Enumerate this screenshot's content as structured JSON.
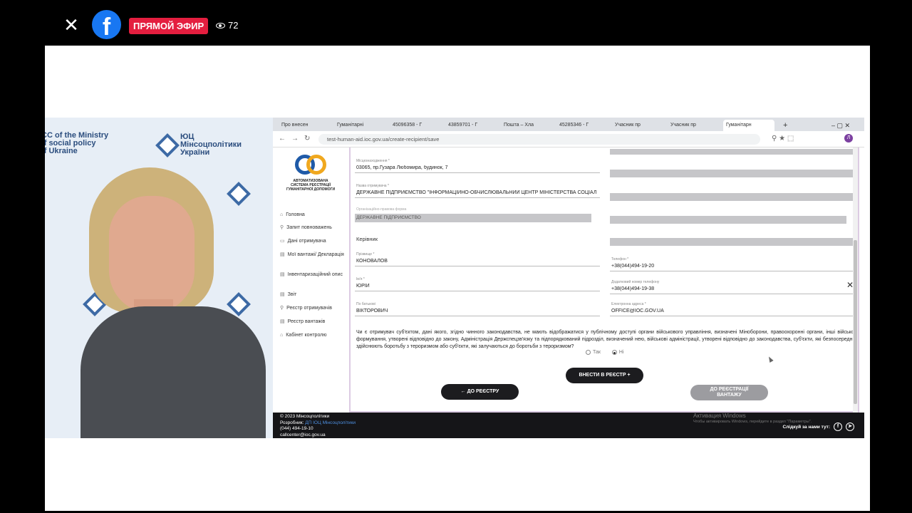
{
  "fb": {
    "live_label": "ПРЯМОЙ ЭФИР",
    "viewers": "72",
    "logo_letter": "f",
    "close": "✕"
  },
  "cam": {
    "logo_ua": "ЮЦ\nМінсоцполітики\nУкраїни",
    "logo_en": "ICC of the Ministry\nof social policy\nof Ukraine"
  },
  "browser": {
    "tabs": [
      "Про внесен",
      "Гуманітарні",
      "45096358 - Г",
      "43859701 - Г",
      "Пошта – Хла",
      "45285346 - Г",
      "Учасник пр",
      "Учасник пр",
      "Гуманітарн"
    ],
    "url": "test-human-aid.ioc.gov.ua/create-recipient/save"
  },
  "sidebar": {
    "logo_text": "АВТОМАТИЗОВАНА\nСИСТЕМА РЕЄСТРАЦІЇ\nГУМАНІТАРНОЇ ДОПОМОГИ",
    "items": [
      {
        "icon": "⌂",
        "label": "Головна"
      },
      {
        "icon": "⚲",
        "label": "Запит повноважень"
      },
      {
        "icon": "▭",
        "label": "Дані отримувача"
      },
      {
        "icon": "▤",
        "label": "Мої вантажі/ Декларація"
      },
      {
        "icon": "▤",
        "label": "Інвентаризаційний опис"
      },
      {
        "icon": "▤",
        "label": "Звіт"
      },
      {
        "icon": "⚲",
        "label": "Реєстр отримувачів"
      },
      {
        "icon": "▤",
        "label": "Реєстр вантажів"
      },
      {
        "icon": "⌂",
        "label": "Кабінет контролю"
      }
    ]
  },
  "form": {
    "address_label": "Місцезнаходження *",
    "address": "03065, пр.Гузара Любомира, будинок, 7",
    "name_label": "Назва отримувача *",
    "name": "ДЕРЖАВНЕ ПІДПРИЄМСТВО \"ІНФОРМАЦІЙНО-ОБЧИСЛЮВАЛЬНИЙ ЦЕНТР МІНІСТЕРСТВА СОЦІАЛЬНОЇ ПОЛІТИКИ",
    "legal_form_label": "Організаційно-правова форма",
    "legal_form": "ДЕРЖАВНЕ ПІДПРИЄМСТВО",
    "head_section": "Керівник",
    "surname_label": "Прізвище *",
    "surname": "КОНОВАЛОВ",
    "firstname_label": "Ім'я *",
    "firstname": "ЮРІЙ",
    "patronymic_label": "По батькові",
    "patronymic": "ВІКТОРОВИЧ",
    "phone_label": "Телефон *",
    "phone": "+38(044)494-19-20",
    "phone2_label": "Додатковий номер телефону",
    "phone2": "+38(044)494-19-38",
    "email_label": "Електронна адреса *",
    "email": "OFFICE@IOC.GOV.UA",
    "question": "Чи є отримувач суб'єктом, дані якого, згідно чинного законодавства, не мають відображатися у публічному доступі органи військового управління, визначені Міноборони, правоохоронні органи, інші військові формування, утворені відповідно до закону, Адміністрація Держспецзв'язку та підпорядкований підрозділ, визначений нею, військові адміністрації, утворені відповідно до законодавства, суб'єкти, які безпосередньо здійснюють боротьбу з тероризмом або суб'єкти, які залучаються до боротьби з тероризмом?",
    "yes": "Так",
    "no": "Ні",
    "submit": "ВНЕСТИ В РЕЄСТР",
    "back": "ДО РЕЄСТРУ",
    "cargo": "ДО РЕЄСТРАЦІЇ\nВАНТАЖУ"
  },
  "footer": {
    "copyright": "© 2023 Мінсоцполітики",
    "dev_label": "Розробник:",
    "dev_link": "ДП ІОЦ Мінсоцполітики",
    "phone": "(044) 494-19-10",
    "email": "callcenter@ioc.gov.ua",
    "follow": "Слідкуй за нами тут:",
    "win_title": "Активация Windows",
    "win_sub": "Чтобы активировать Windows, перейдите в раздел \"Параметры\"."
  }
}
